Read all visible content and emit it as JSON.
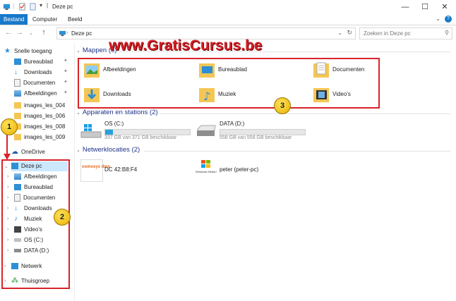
{
  "window": {
    "title": "Deze pc",
    "controls": [
      "—",
      "☐",
      "✕"
    ]
  },
  "ribbon": {
    "tabs": [
      "Bestand",
      "Computer",
      "Beeld"
    ],
    "help": "?"
  },
  "address": {
    "path": "Deze pc",
    "search_placeholder": "Zoeken in Deze pc"
  },
  "watermark": "www.GratisCursus.be",
  "sidebar": {
    "quick_access": {
      "label": "Snelle toegang",
      "items": [
        {
          "label": "Bureaublad",
          "pinned": true
        },
        {
          "label": "Downloads",
          "pinned": true
        },
        {
          "label": "Documenten",
          "pinned": true
        },
        {
          "label": "Afbeeldingen",
          "pinned": true
        },
        {
          "label": "images_les_004",
          "pinned": false
        },
        {
          "label": "images_les_006",
          "pinned": false
        },
        {
          "label": "images_les_008",
          "pinned": false
        },
        {
          "label": "images_les_009",
          "pinned": false
        }
      ]
    },
    "onedrive": "OneDrive",
    "this_pc": {
      "label": "Deze pc",
      "items": [
        "Afbeeldingen",
        "Bureaublad",
        "Documenten",
        "Downloads",
        "Muziek",
        "Video's",
        "OS (C:)",
        "DATA (D:)"
      ]
    },
    "network": "Netwerk",
    "homegroup": "Thuisgroep"
  },
  "main": {
    "folders_header": "Mappen (6)",
    "folders": [
      "Afbeeldingen",
      "Bureaublad",
      "Documenten",
      "Downloads",
      "Muziek",
      "Video's"
    ],
    "devices_header": "Apparaten en stations (2)",
    "drives": [
      {
        "name": "OS (C:)",
        "space": "337 GB van 371 GB beschikbaar",
        "used_fraction": 0.09
      },
      {
        "name": "DATA (D:)",
        "space": "558 GB van 558 GB beschikbaar",
        "used_fraction": 0.0
      }
    ],
    "network_header": "Netwerklocaties (2)",
    "network_locations": [
      {
        "name": "DC 42:B8:F4",
        "logo": "osmosys dms"
      },
      {
        "name": "peter (peter-pc)",
        "logo": "Windows Media Player"
      }
    ]
  },
  "callouts": [
    "1",
    "2",
    "3"
  ],
  "colors": {
    "accent": "#1979ca",
    "callout_border": "#d8232a",
    "header_text": "#1e3287"
  }
}
